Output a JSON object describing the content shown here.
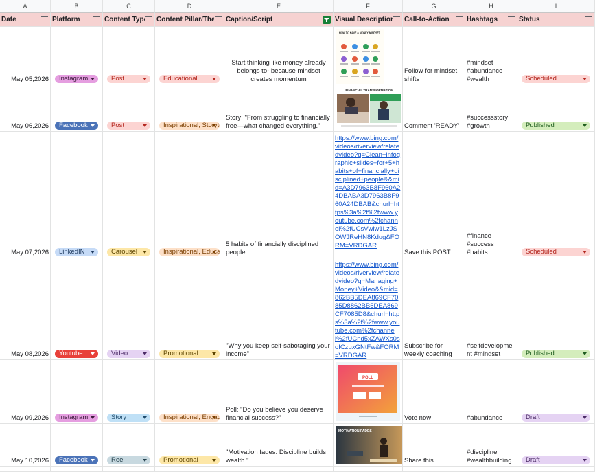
{
  "column_letters": [
    "A",
    "B",
    "C",
    "D",
    "E",
    "F",
    "G",
    "H",
    "I"
  ],
  "headers": [
    "Date",
    "Platform",
    "Content Type",
    "Content Pillar/Theme",
    "Caption/Script",
    "Visual Description",
    "Call-to-Action",
    "Hashtags",
    "Status"
  ],
  "rows": [
    {
      "date": "May 05,2026",
      "platform": "Instagram",
      "content_type": "Post",
      "pillar": "Educational",
      "caption": "Start thinking like money already belongs to- because mindset creates momentum",
      "visual_text": "HOW TO HAVE A MONEY MINDSET",
      "cta": "Follow for mindset shifts",
      "hashtags": "#mindset #abundance #wealth",
      "status": "Scheduled"
    },
    {
      "date": "May 06,2026",
      "platform": "Facebook",
      "content_type": "Post",
      "pillar": "Inspirational, Storytelling",
      "caption": "Story: \"From struggling to financially free—what changed everything.\"",
      "visual_text": "FINANCIAL TRANSFORMATION",
      "cta": "Comment 'READY'",
      "hashtags": "#successstory #growth",
      "status": "Published"
    },
    {
      "date": "May 07,2026",
      "platform": "LinkedIN",
      "content_type": "Carousel",
      "pillar": "Inspirational, Educational",
      "caption": "5 habits of financially disciplined people",
      "visual_link": "https://www.bing.com/videos/riverview/relatedvideo?q=Clean+infographic+slides+for+5+habits+of+financially+disciplined+people&&mid=A3D7963B8F960A24DBABA3D7963B8F960A24DBAB&churl=https%3a%2f%2fwww.youtube.com%2fchannel%2fUCsVwiw1LzJSOWJReHN8Kdug&FORM=VRDGAR",
      "cta": "Save this POST",
      "hashtags": "#finance #success #habits",
      "status": "Scheduled"
    },
    {
      "date": "May 08,2026",
      "platform": "Youtube",
      "content_type": "Video",
      "pillar": "Promotional",
      "caption": "\"Why you keep self-sabotaging your income\"",
      "visual_link": "https://www.bing.com/videos/riverview/relatedvideo?q=Managing+Money+Video&&mid=862BB5DEA869CF7085D8862BB5DEA869CF7085D8&churl=https%3a%2f%2fwww.youtube.com%2fchannel%2fUCnd5xZAWXs0soICzuxGNtFw&FORM=VRDGAR",
      "cta": "Subscribe for weekly coaching",
      "hashtags": "#selfdevelopment #mindset",
      "status": "Published"
    },
    {
      "date": "May 09,2026",
      "platform": "Instagram",
      "content_type": "Story",
      "pillar": "Inspirational, Engagement",
      "caption": "Poll: \"Do you believe you deserve financial success?\"",
      "visual_text": "POLL",
      "cta": "Vote now",
      "hashtags": "#abundance",
      "status": "Draft"
    },
    {
      "date": "May 10,2026",
      "platform": "Facebook",
      "content_type": "Reel",
      "pillar": "Promotional",
      "caption": "\"Motivation fades. Discipline builds wealth.\"",
      "visual_text": "MOTIVATION FADES",
      "cta": "Share this",
      "hashtags": "#discipline #wealthbuilding",
      "status": "Draft"
    }
  ],
  "chip_colors": {
    "Instagram": {
      "bg": "#e59ee0",
      "fg": "#3b1a3a"
    },
    "Facebook": {
      "bg": "#4b73b8",
      "fg": "#ffffff"
    },
    "LinkedIN": {
      "bg": "#c6dbf7",
      "fg": "#1e3a5f"
    },
    "Youtube": {
      "bg": "#e8403a",
      "fg": "#ffffff"
    },
    "Post": {
      "bg": "#fcd4d2",
      "fg": "#b3261e"
    },
    "Carousel": {
      "bg": "#fde7a7",
      "fg": "#5c4400"
    },
    "Video": {
      "bg": "#e5d3f3",
      "fg": "#4a2a66"
    },
    "Story": {
      "bg": "#bfe0f6",
      "fg": "#1d4a6b"
    },
    "Reel": {
      "bg": "#c8d9e0",
      "fg": "#23404c"
    },
    "Educational": {
      "bg": "#fcd4d2",
      "fg": "#b3261e"
    },
    "Inspirational, Storytelling": {
      "bg": "#fde0c8",
      "fg": "#7a3e00"
    },
    "Inspirational, Educational": {
      "bg": "#fde0c8",
      "fg": "#7a3e00"
    },
    "Inspirational, Engagement": {
      "bg": "#fde0c8",
      "fg": "#7a3e00"
    },
    "Promotional": {
      "bg": "#fde7a7",
      "fg": "#5c4400"
    },
    "Scheduled": {
      "bg": "#fcd4d2",
      "fg": "#b3261e"
    },
    "Published": {
      "bg": "#d4edbc",
      "fg": "#1e5c1e"
    },
    "Draft": {
      "bg": "#e5d3f3",
      "fg": "#4a2a66"
    }
  },
  "icons": {
    "header_filter": "filter-lines-icon",
    "active_filter": "funnel-icon",
    "chip_dropdown": "chevron-down-icon"
  }
}
